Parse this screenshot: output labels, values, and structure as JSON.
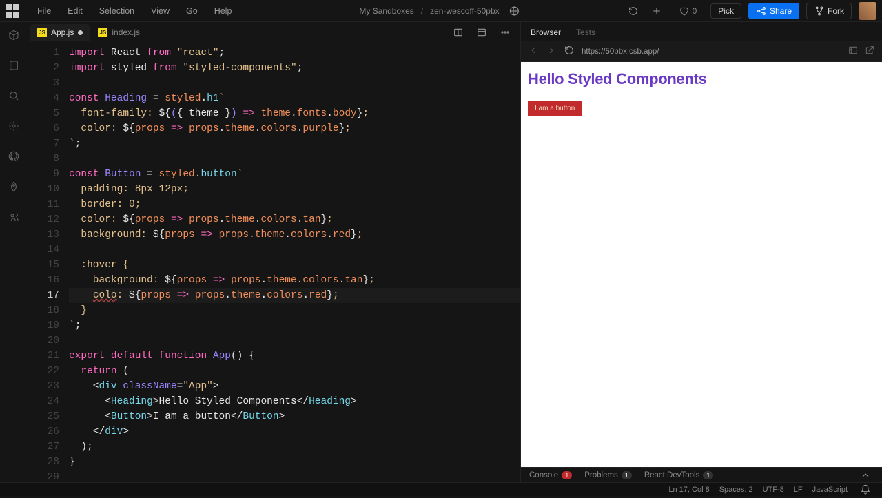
{
  "menu": [
    "File",
    "Edit",
    "Selection",
    "View",
    "Go",
    "Help"
  ],
  "breadcrumb": {
    "parent": "My Sandboxes",
    "name": "zen-wescoff-50pbx"
  },
  "likes": "0",
  "top_buttons": {
    "pick": "Pick",
    "share": "Share",
    "fork": "Fork"
  },
  "tabs": [
    {
      "label": "App.js",
      "active": true,
      "dirty": true
    },
    {
      "label": "index.js",
      "active": false,
      "dirty": false
    }
  ],
  "gutter": [
    "1",
    "2",
    "3",
    "4",
    "5",
    "6",
    "7",
    "8",
    "9",
    "10",
    "11",
    "12",
    "13",
    "14",
    "15",
    "16",
    "17",
    "18",
    "19",
    "20",
    "21",
    "22",
    "23",
    "24",
    "25",
    "26",
    "27",
    "28",
    "29"
  ],
  "current_line": 17,
  "code_tokens": [
    [
      [
        "pink",
        "import"
      ],
      [
        "white",
        " React "
      ],
      [
        "pink",
        "from"
      ],
      [
        "white",
        " "
      ],
      [
        "str",
        "\"react\""
      ],
      [
        "white",
        ";"
      ]
    ],
    [
      [
        "pink",
        "import"
      ],
      [
        "white",
        " styled "
      ],
      [
        "pink",
        "from"
      ],
      [
        "white",
        " "
      ],
      [
        "str",
        "\"styled-components\""
      ],
      [
        "white",
        ";"
      ]
    ],
    [],
    [
      [
        "pink",
        "const"
      ],
      [
        "white",
        " "
      ],
      [
        "purple",
        "Heading"
      ],
      [
        "white",
        " = "
      ],
      [
        "orange",
        "styled"
      ],
      [
        "white",
        "."
      ],
      [
        "cyan",
        "h1"
      ],
      [
        "str",
        "`"
      ]
    ],
    [
      [
        "str",
        "  font-family: "
      ],
      [
        "white",
        "${"
      ],
      [
        "purple",
        "("
      ],
      [
        "white",
        "{ theme }"
      ],
      [
        "purple",
        ")"
      ],
      [
        "white",
        " "
      ],
      [
        "pink",
        "=>"
      ],
      [
        "white",
        " "
      ],
      [
        "orange",
        "theme"
      ],
      [
        "white",
        "."
      ],
      [
        "orange",
        "fonts"
      ],
      [
        "white",
        "."
      ],
      [
        "orange",
        "body"
      ],
      [
        "white",
        "}"
      ],
      [
        "str",
        ";"
      ]
    ],
    [
      [
        "str",
        "  color: "
      ],
      [
        "white",
        "${"
      ],
      [
        "orange",
        "props"
      ],
      [
        "white",
        " "
      ],
      [
        "pink",
        "=>"
      ],
      [
        "white",
        " "
      ],
      [
        "orange",
        "props"
      ],
      [
        "white",
        "."
      ],
      [
        "orange",
        "theme"
      ],
      [
        "white",
        "."
      ],
      [
        "orange",
        "colors"
      ],
      [
        "white",
        "."
      ],
      [
        "orange",
        "purple"
      ],
      [
        "white",
        "}"
      ],
      [
        "str",
        ";"
      ]
    ],
    [
      [
        "str",
        "`"
      ],
      [
        "white",
        ";"
      ]
    ],
    [],
    [
      [
        "pink",
        "const"
      ],
      [
        "white",
        " "
      ],
      [
        "purple",
        "Button"
      ],
      [
        "white",
        " = "
      ],
      [
        "orange",
        "styled"
      ],
      [
        "white",
        "."
      ],
      [
        "cyan",
        "button"
      ],
      [
        "str",
        "`"
      ]
    ],
    [
      [
        "str",
        "  padding: 8px 12px;"
      ]
    ],
    [
      [
        "str",
        "  border: 0;"
      ]
    ],
    [
      [
        "str",
        "  color: "
      ],
      [
        "white",
        "${"
      ],
      [
        "orange",
        "props"
      ],
      [
        "white",
        " "
      ],
      [
        "pink",
        "=>"
      ],
      [
        "white",
        " "
      ],
      [
        "orange",
        "props"
      ],
      [
        "white",
        "."
      ],
      [
        "orange",
        "theme"
      ],
      [
        "white",
        "."
      ],
      [
        "orange",
        "colors"
      ],
      [
        "white",
        "."
      ],
      [
        "orange",
        "tan"
      ],
      [
        "white",
        "}"
      ],
      [
        "str",
        ";"
      ]
    ],
    [
      [
        "str",
        "  background: "
      ],
      [
        "white",
        "${"
      ],
      [
        "orange",
        "props"
      ],
      [
        "white",
        " "
      ],
      [
        "pink",
        "=>"
      ],
      [
        "white",
        " "
      ],
      [
        "orange",
        "props"
      ],
      [
        "white",
        "."
      ],
      [
        "orange",
        "theme"
      ],
      [
        "white",
        "."
      ],
      [
        "orange",
        "colors"
      ],
      [
        "white",
        "."
      ],
      [
        "orange",
        "red"
      ],
      [
        "white",
        "}"
      ],
      [
        "str",
        ";"
      ]
    ],
    [],
    [
      [
        "str",
        "  :hover {"
      ]
    ],
    [
      [
        "str",
        "    background: "
      ],
      [
        "white",
        "${"
      ],
      [
        "orange",
        "props"
      ],
      [
        "white",
        " "
      ],
      [
        "pink",
        "=>"
      ],
      [
        "white",
        " "
      ],
      [
        "orange",
        "props"
      ],
      [
        "white",
        "."
      ],
      [
        "orange",
        "theme"
      ],
      [
        "white",
        "."
      ],
      [
        "orange",
        "colors"
      ],
      [
        "white",
        "."
      ],
      [
        "orange",
        "tan"
      ],
      [
        "white",
        "}"
      ],
      [
        "str",
        ";"
      ]
    ],
    [
      [
        "str",
        "    "
      ],
      [
        "errstr",
        "colo"
      ],
      [
        "str",
        ": "
      ],
      [
        "white",
        "${"
      ],
      [
        "orange",
        "props"
      ],
      [
        "white",
        " "
      ],
      [
        "pink",
        "=>"
      ],
      [
        "white",
        " "
      ],
      [
        "orange",
        "props"
      ],
      [
        "white",
        "."
      ],
      [
        "orange",
        "theme"
      ],
      [
        "white",
        "."
      ],
      [
        "orange",
        "colors"
      ],
      [
        "white",
        "."
      ],
      [
        "orange",
        "red"
      ],
      [
        "white",
        "}"
      ],
      [
        "str",
        ";"
      ]
    ],
    [
      [
        "str",
        "  }"
      ]
    ],
    [
      [
        "str",
        "`"
      ],
      [
        "white",
        ";"
      ]
    ],
    [],
    [
      [
        "pink",
        "export"
      ],
      [
        "white",
        " "
      ],
      [
        "pink",
        "default"
      ],
      [
        "white",
        " "
      ],
      [
        "pink",
        "function"
      ],
      [
        "white",
        " "
      ],
      [
        "purple",
        "App"
      ],
      [
        "white",
        "() {"
      ]
    ],
    [
      [
        "white",
        "  "
      ],
      [
        "pink",
        "return"
      ],
      [
        "white",
        " ("
      ]
    ],
    [
      [
        "white",
        "    <"
      ],
      [
        "cyan",
        "div"
      ],
      [
        "white",
        " "
      ],
      [
        "purple",
        "className"
      ],
      [
        "white",
        "="
      ],
      [
        "str",
        "\"App\""
      ],
      [
        "white",
        ">"
      ]
    ],
    [
      [
        "white",
        "      <"
      ],
      [
        "cyan",
        "Heading"
      ],
      [
        "white",
        ">Hello Styled Components</"
      ],
      [
        "cyan",
        "Heading"
      ],
      [
        "white",
        ">"
      ]
    ],
    [
      [
        "white",
        "      <"
      ],
      [
        "cyan",
        "Button"
      ],
      [
        "white",
        ">I am a button</"
      ],
      [
        "cyan",
        "Button"
      ],
      [
        "white",
        ">"
      ]
    ],
    [
      [
        "white",
        "    </"
      ],
      [
        "cyan",
        "div"
      ],
      [
        "white",
        ">"
      ]
    ],
    [
      [
        "white",
        "  );"
      ]
    ],
    [
      [
        "white",
        "}"
      ]
    ],
    []
  ],
  "preview_tabs": [
    "Browser",
    "Tests"
  ],
  "preview_url": "https://50pbx.csb.app/",
  "preview": {
    "heading": "Hello Styled Components",
    "button": "I am a button"
  },
  "bottom_panel": {
    "console": "Console",
    "console_badge": "1",
    "problems": "Problems",
    "problems_badge": "1",
    "react": "React DevTools",
    "react_badge": "1"
  },
  "status": {
    "position": "Ln 17, Col 8",
    "spaces": "Spaces: 2",
    "encoding": "UTF-8",
    "eol": "LF",
    "lang": "JavaScript"
  },
  "colors": {
    "accent": "#0971f1",
    "red": "#c22b2b",
    "purple": "#6b3ac4"
  }
}
